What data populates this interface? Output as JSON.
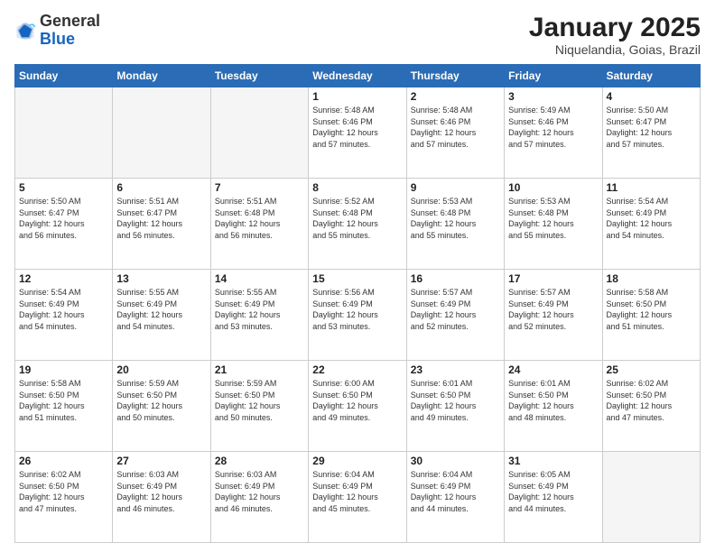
{
  "header": {
    "logo_general": "General",
    "logo_blue": "Blue",
    "month_title": "January 2025",
    "location": "Niquelandia, Goias, Brazil"
  },
  "days_of_week": [
    "Sunday",
    "Monday",
    "Tuesday",
    "Wednesday",
    "Thursday",
    "Friday",
    "Saturday"
  ],
  "weeks": [
    [
      {
        "day": "",
        "info": ""
      },
      {
        "day": "",
        "info": ""
      },
      {
        "day": "",
        "info": ""
      },
      {
        "day": "1",
        "info": "Sunrise: 5:48 AM\nSunset: 6:46 PM\nDaylight: 12 hours\nand 57 minutes."
      },
      {
        "day": "2",
        "info": "Sunrise: 5:48 AM\nSunset: 6:46 PM\nDaylight: 12 hours\nand 57 minutes."
      },
      {
        "day": "3",
        "info": "Sunrise: 5:49 AM\nSunset: 6:46 PM\nDaylight: 12 hours\nand 57 minutes."
      },
      {
        "day": "4",
        "info": "Sunrise: 5:50 AM\nSunset: 6:47 PM\nDaylight: 12 hours\nand 57 minutes."
      }
    ],
    [
      {
        "day": "5",
        "info": "Sunrise: 5:50 AM\nSunset: 6:47 PM\nDaylight: 12 hours\nand 56 minutes."
      },
      {
        "day": "6",
        "info": "Sunrise: 5:51 AM\nSunset: 6:47 PM\nDaylight: 12 hours\nand 56 minutes."
      },
      {
        "day": "7",
        "info": "Sunrise: 5:51 AM\nSunset: 6:48 PM\nDaylight: 12 hours\nand 56 minutes."
      },
      {
        "day": "8",
        "info": "Sunrise: 5:52 AM\nSunset: 6:48 PM\nDaylight: 12 hours\nand 55 minutes."
      },
      {
        "day": "9",
        "info": "Sunrise: 5:53 AM\nSunset: 6:48 PM\nDaylight: 12 hours\nand 55 minutes."
      },
      {
        "day": "10",
        "info": "Sunrise: 5:53 AM\nSunset: 6:48 PM\nDaylight: 12 hours\nand 55 minutes."
      },
      {
        "day": "11",
        "info": "Sunrise: 5:54 AM\nSunset: 6:49 PM\nDaylight: 12 hours\nand 54 minutes."
      }
    ],
    [
      {
        "day": "12",
        "info": "Sunrise: 5:54 AM\nSunset: 6:49 PM\nDaylight: 12 hours\nand 54 minutes."
      },
      {
        "day": "13",
        "info": "Sunrise: 5:55 AM\nSunset: 6:49 PM\nDaylight: 12 hours\nand 54 minutes."
      },
      {
        "day": "14",
        "info": "Sunrise: 5:55 AM\nSunset: 6:49 PM\nDaylight: 12 hours\nand 53 minutes."
      },
      {
        "day": "15",
        "info": "Sunrise: 5:56 AM\nSunset: 6:49 PM\nDaylight: 12 hours\nand 53 minutes."
      },
      {
        "day": "16",
        "info": "Sunrise: 5:57 AM\nSunset: 6:49 PM\nDaylight: 12 hours\nand 52 minutes."
      },
      {
        "day": "17",
        "info": "Sunrise: 5:57 AM\nSunset: 6:49 PM\nDaylight: 12 hours\nand 52 minutes."
      },
      {
        "day": "18",
        "info": "Sunrise: 5:58 AM\nSunset: 6:50 PM\nDaylight: 12 hours\nand 51 minutes."
      }
    ],
    [
      {
        "day": "19",
        "info": "Sunrise: 5:58 AM\nSunset: 6:50 PM\nDaylight: 12 hours\nand 51 minutes."
      },
      {
        "day": "20",
        "info": "Sunrise: 5:59 AM\nSunset: 6:50 PM\nDaylight: 12 hours\nand 50 minutes."
      },
      {
        "day": "21",
        "info": "Sunrise: 5:59 AM\nSunset: 6:50 PM\nDaylight: 12 hours\nand 50 minutes."
      },
      {
        "day": "22",
        "info": "Sunrise: 6:00 AM\nSunset: 6:50 PM\nDaylight: 12 hours\nand 49 minutes."
      },
      {
        "day": "23",
        "info": "Sunrise: 6:01 AM\nSunset: 6:50 PM\nDaylight: 12 hours\nand 49 minutes."
      },
      {
        "day": "24",
        "info": "Sunrise: 6:01 AM\nSunset: 6:50 PM\nDaylight: 12 hours\nand 48 minutes."
      },
      {
        "day": "25",
        "info": "Sunrise: 6:02 AM\nSunset: 6:50 PM\nDaylight: 12 hours\nand 47 minutes."
      }
    ],
    [
      {
        "day": "26",
        "info": "Sunrise: 6:02 AM\nSunset: 6:50 PM\nDaylight: 12 hours\nand 47 minutes."
      },
      {
        "day": "27",
        "info": "Sunrise: 6:03 AM\nSunset: 6:49 PM\nDaylight: 12 hours\nand 46 minutes."
      },
      {
        "day": "28",
        "info": "Sunrise: 6:03 AM\nSunset: 6:49 PM\nDaylight: 12 hours\nand 46 minutes."
      },
      {
        "day": "29",
        "info": "Sunrise: 6:04 AM\nSunset: 6:49 PM\nDaylight: 12 hours\nand 45 minutes."
      },
      {
        "day": "30",
        "info": "Sunrise: 6:04 AM\nSunset: 6:49 PM\nDaylight: 12 hours\nand 44 minutes."
      },
      {
        "day": "31",
        "info": "Sunrise: 6:05 AM\nSunset: 6:49 PM\nDaylight: 12 hours\nand 44 minutes."
      },
      {
        "day": "",
        "info": ""
      }
    ]
  ]
}
